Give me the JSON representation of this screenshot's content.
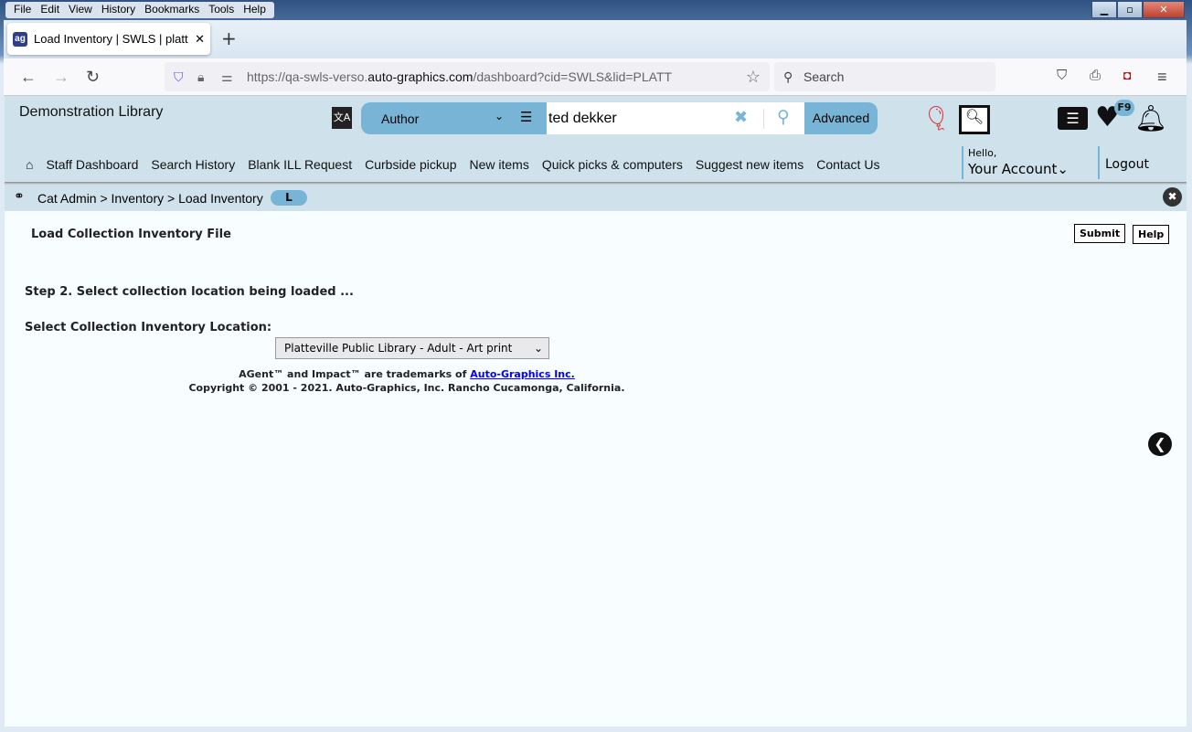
{
  "browser": {
    "menu": [
      "File",
      "Edit",
      "View",
      "History",
      "Bookmarks",
      "Tools",
      "Help"
    ],
    "tab_title": "Load Inventory | SWLS | platt | A",
    "url_prefix": "https://qa-swls-verso.",
    "url_domain": "auto-graphics.com",
    "url_suffix": "/dashboard?cid=SWLS&lid=PLATT",
    "search_placeholder": "Search"
  },
  "header": {
    "library_name": "Demonstration Library",
    "search_type": "Author",
    "search_value": "ted dekker",
    "advanced_label": "Advanced",
    "favorites_badge": "F9",
    "nav": [
      "Staff Dashboard",
      "Search History",
      "Blank ILL Request",
      "Curbside pickup",
      "New items",
      "Quick picks & computers",
      "Suggest new items",
      "Contact Us"
    ],
    "hello": "Hello,",
    "account": "Your Account",
    "logout": "Logout"
  },
  "breadcrumb": {
    "text": "Cat Admin > Inventory > Load Inventory",
    "pill": "L"
  },
  "main": {
    "title": "Load Collection Inventory File",
    "submit": "Submit",
    "help": "Help",
    "step": "Step 2. Select collection location being loaded ...",
    "select_label": "Select Collection Inventory Location:",
    "select_value": "Platteville Public Library - Adult - Art print"
  },
  "footer": {
    "trademark": "AGent™ and Impact™ are trademarks of ",
    "link": "Auto-Graphics Inc.",
    "copyright": "Copyright © 2001 - 2021. Auto-Graphics, Inc. Rancho Cucamonga, California."
  },
  "colors": {
    "header_bg": "#cfe2ec",
    "accent": "#78b4d6",
    "link": "#0000ff"
  }
}
